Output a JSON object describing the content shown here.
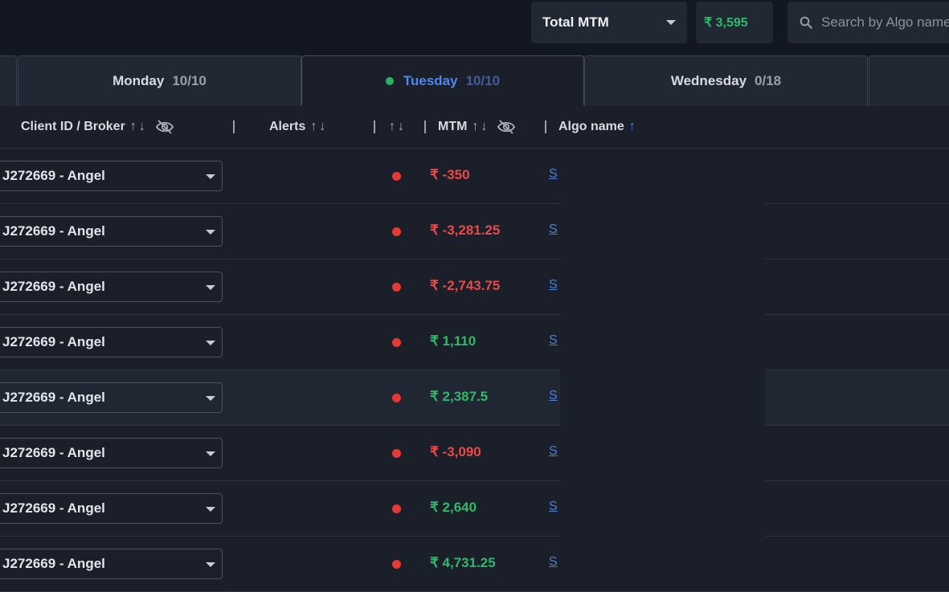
{
  "header": {
    "mtm_select_label": "Total MTM",
    "total_mtm": "₹ 3,595",
    "search_placeholder": "Search by Algo name"
  },
  "tabs": [
    {
      "day": "Monday",
      "count": "10/10"
    },
    {
      "day": "Tuesday",
      "count": "10/10",
      "active": true
    },
    {
      "day": "Wednesday",
      "count": "0/18"
    }
  ],
  "columns": {
    "client": "Client ID / Broker",
    "alerts": "Alerts",
    "mtm": "MTM",
    "algo": "Algo name"
  },
  "rows": [
    {
      "client": "J272669 - Angel",
      "mtm": "₹ -350",
      "algo": "S"
    },
    {
      "client": "J272669 - Angel",
      "mtm": "₹ -3,281.25",
      "algo": "S"
    },
    {
      "client": "J272669 - Angel",
      "mtm": "₹ -2,743.75",
      "algo": "S"
    },
    {
      "client": "J272669 - Angel",
      "mtm": "₹ 1,110",
      "algo": "S"
    },
    {
      "client": "J272669 - Angel",
      "mtm": "₹ 2,387.5",
      "algo": "S"
    },
    {
      "client": "J272669 - Angel",
      "mtm": "₹ -3,090",
      "algo": "S"
    },
    {
      "client": "J272669 - Angel",
      "mtm": "₹ 2,640",
      "algo": "S"
    },
    {
      "client": "J272669 - Angel",
      "mtm": "₹ 4,731.25",
      "algo": "S"
    }
  ],
  "colors": {
    "positive": "#2fb96a",
    "negative": "#e84a4a",
    "accent": "#4d86f3",
    "status_dot": "#e53935"
  }
}
